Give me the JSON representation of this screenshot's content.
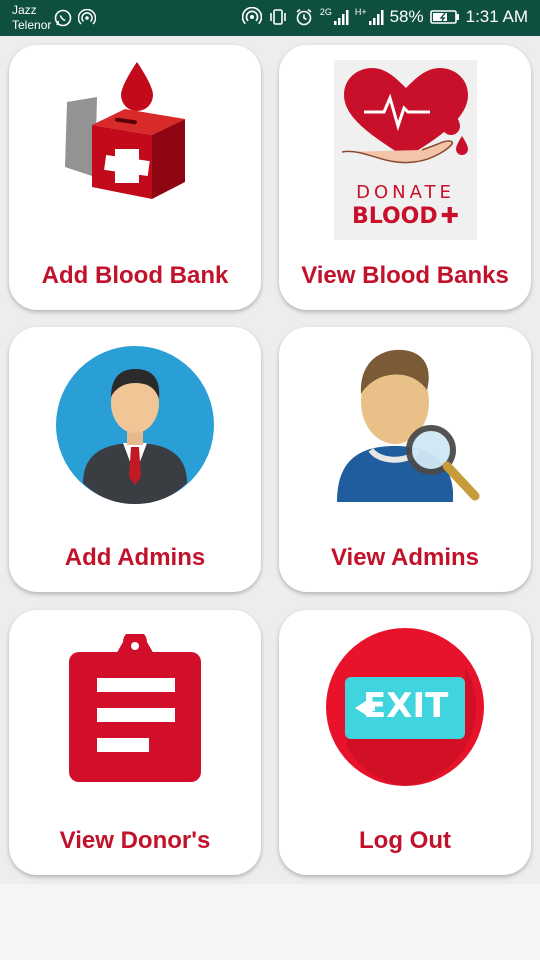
{
  "status_bar": {
    "carrier_1": "Jazz",
    "carrier_2": "Telenor",
    "network_1": "2G",
    "network_2": "H+",
    "battery": "58%",
    "time": "1:31 AM",
    "left_icons": [
      "whatsapp-icon",
      "hotspot-icon"
    ],
    "right_icons": [
      "hotspot-icon",
      "vibrate-icon",
      "alarm-icon",
      "signal-icon",
      "signal-icon",
      "battery-icon"
    ]
  },
  "menu": {
    "items": [
      {
        "label": "Add Blood Bank",
        "icon": "blood-bank-box-icon"
      },
      {
        "label": "View Blood Banks",
        "icon": "donate-blood-icon"
      },
      {
        "label": "Add Admins",
        "icon": "admin-avatar-icon"
      },
      {
        "label": "View Admins",
        "icon": "user-search-icon"
      },
      {
        "label": "View Donor's",
        "icon": "clipboard-icon"
      },
      {
        "label": "Log Out",
        "icon": "exit-icon"
      }
    ],
    "image_text": {
      "donate": "DONATE",
      "blood": "BLOOD",
      "exit": "EXIT"
    }
  },
  "colors": {
    "status_bar": "#0f4f3f",
    "accent_red": "#c2122b",
    "card_bg": "#ffffff",
    "grid_bg": "#ededed"
  }
}
